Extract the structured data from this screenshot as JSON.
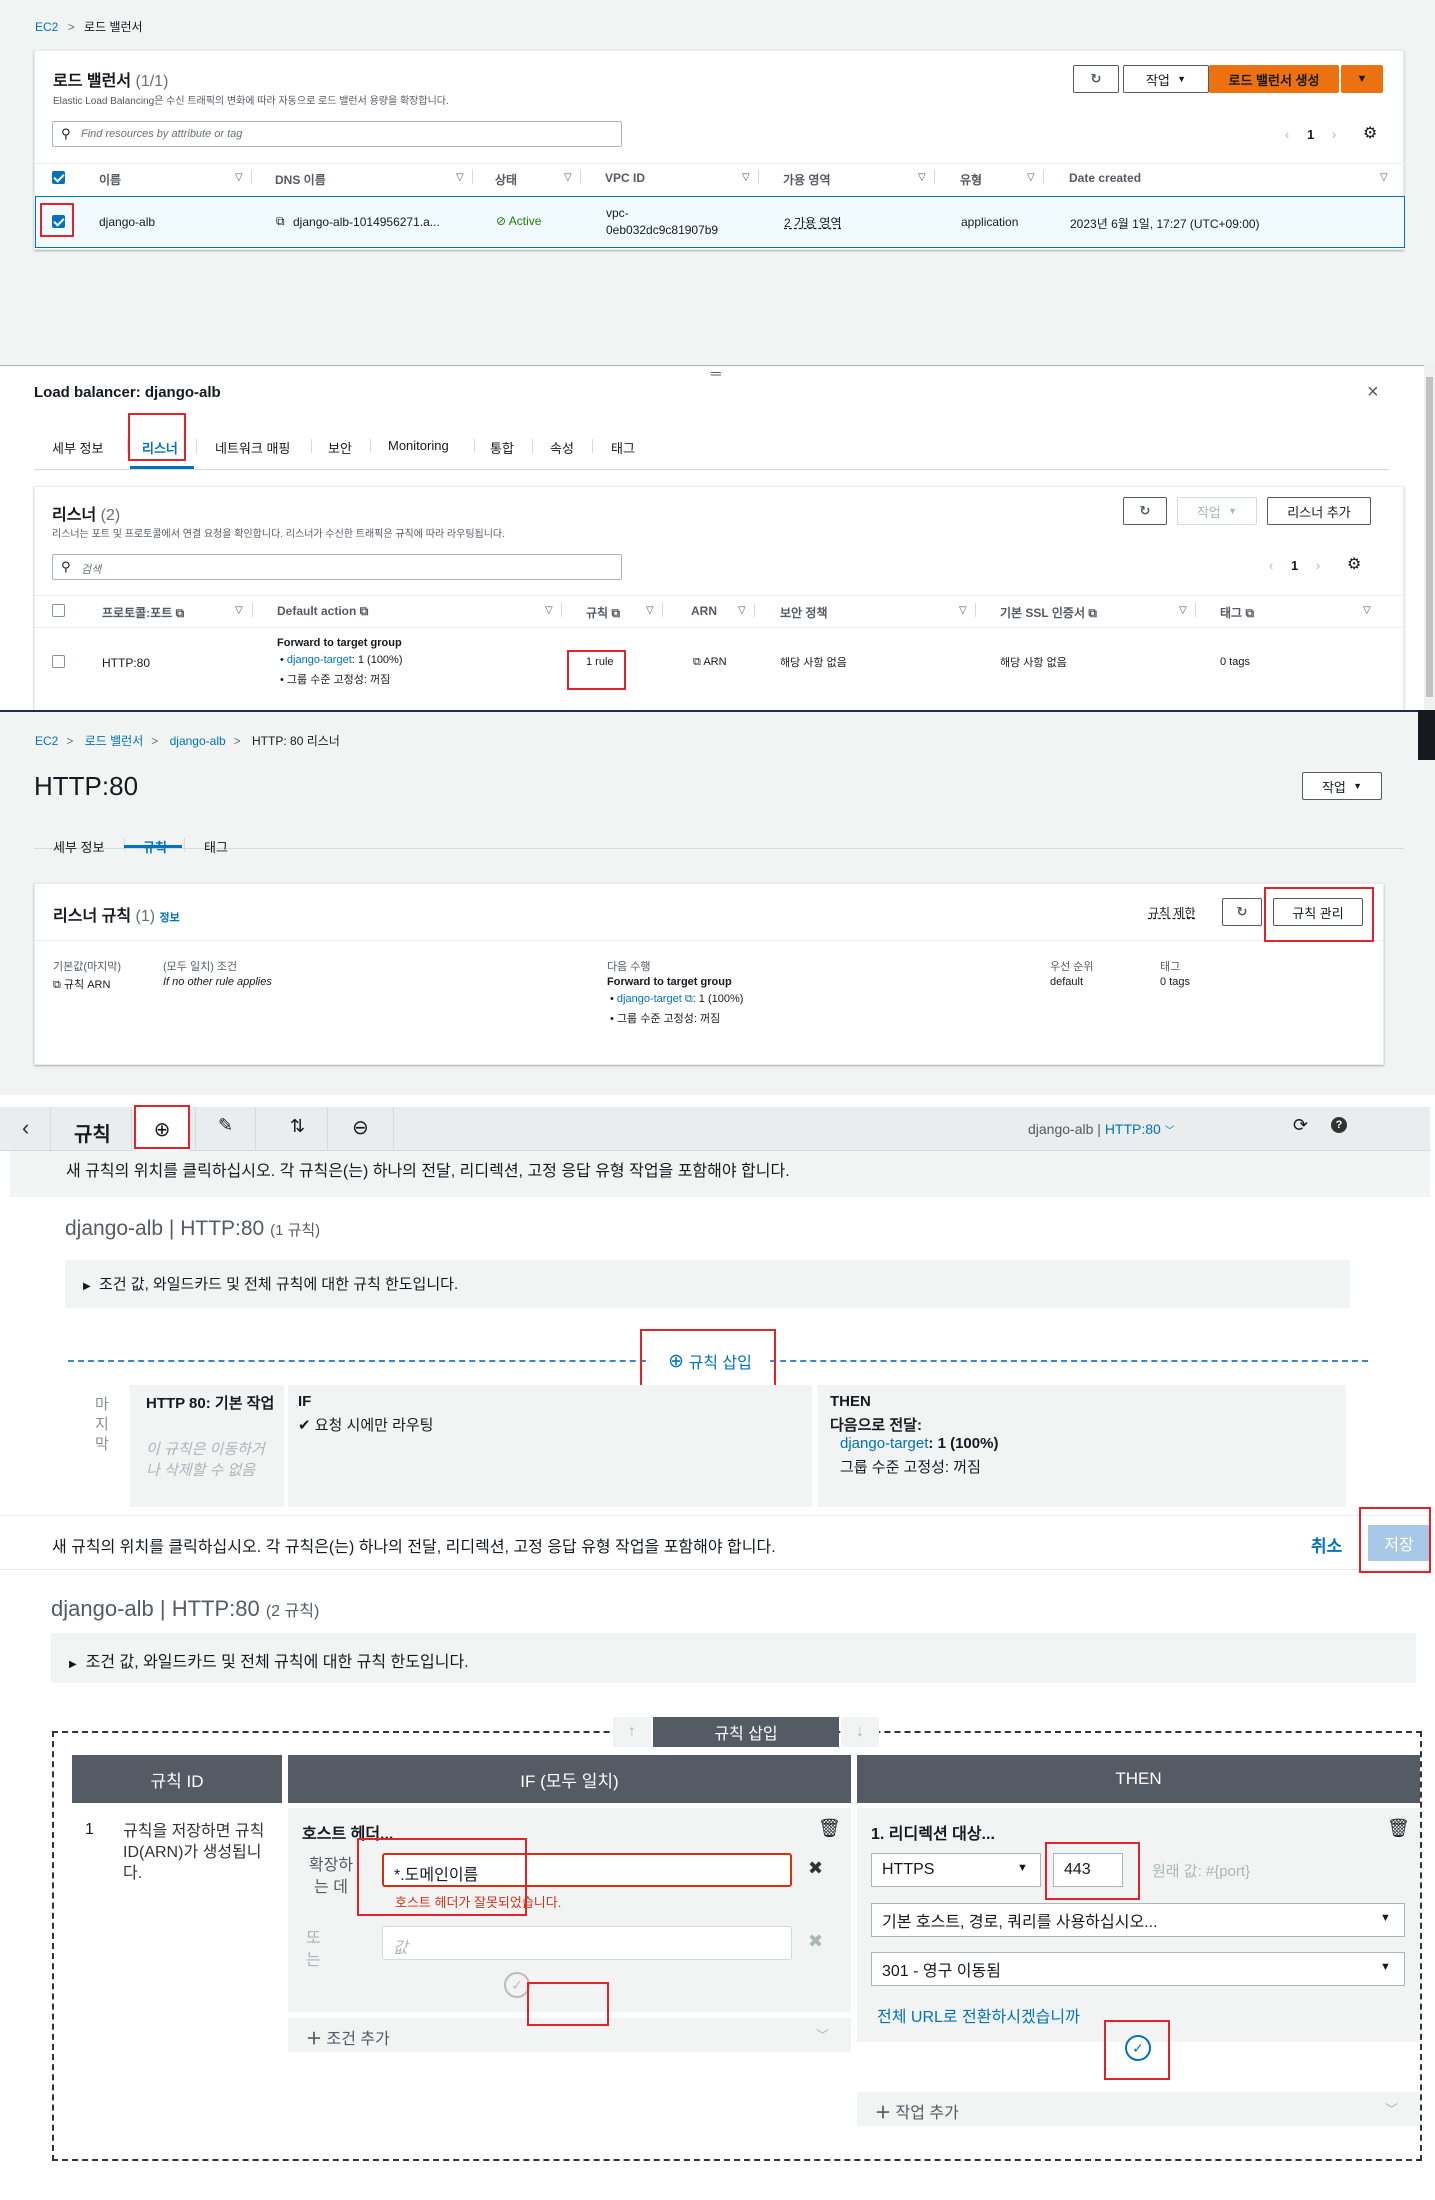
{
  "s1": {
    "breadcrumb": [
      "EC2",
      "로드 밸런서"
    ],
    "title": "로드 밸런서",
    "count": "(1/1)",
    "desc": "Elastic Load Balancing은 수신 트래픽의 변화에 따라 자동으로 로드 밸런서 용량을 확장합니다.",
    "actions_label": "작업",
    "create_label": "로드 밸런서 생성",
    "search_placeholder": "Find resources by attribute or tag",
    "page": "1",
    "columns": [
      "이름",
      "DNS 이름",
      "상태",
      "VPC ID",
      "가용 영역",
      "유형",
      "Date created"
    ],
    "row": {
      "name": "django-alb",
      "dns": "django-alb-1014956271.a...",
      "state": "Active",
      "vpc1": "vpc-",
      "vpc2": "0eb032dc9c81907b9",
      "az": "2 가용 영역",
      "type": "application",
      "created": "2023년 6월 1일, 17:27 (UTC+09:00)"
    }
  },
  "s2": {
    "title": "Load balancer: django-alb",
    "tabs": [
      "세부 정보",
      "리스너",
      "네트워크 매핑",
      "보안",
      "Monitoring",
      "통합",
      "속성",
      "태그"
    ],
    "listeners_title": "리스너",
    "listeners_count": "(2)",
    "listeners_desc": "리스너는 포트 및 프로토콜에서 연결 요청을 확인합니다. 리스너가 수신한 트래픽은 규칙에 따라 라우팅됩니다.",
    "actions_label": "작업",
    "add_listener_label": "리스너 추가",
    "search_placeholder": "검색",
    "page": "1",
    "columns": [
      "프로토콜:포트",
      "Default action",
      "규칙",
      "ARN",
      "보안 정책",
      "기본 SSL 인증서",
      "태그"
    ],
    "row": {
      "protocol": "HTTP:80",
      "fwd": "Forward to target group",
      "target": "django-target",
      "target_pct": ": 1 (100%)",
      "stickiness": "그룹 수준 고정성: 꺼짐",
      "rules": "1 rule",
      "arn": "ARN",
      "policy": "해당 사항 없음",
      "cert": "해당 사항 없음",
      "tags": "0 tags"
    }
  },
  "s3": {
    "breadcrumb": [
      "EC2",
      "로드 밸런서",
      "django-alb",
      "HTTP: 80 리스너"
    ],
    "title": "HTTP:80",
    "actions_label": "작업",
    "tabs": [
      "세부 정보",
      "규칙",
      "태그"
    ],
    "rules_title": "리스너 규칙",
    "rules_count": "(1)",
    "info": "정보",
    "limits_link": "규칙 제한",
    "manage_label": "규칙 관리",
    "col1_h": "기본값(마지막)",
    "col1_v": "규칙 ARN",
    "col2_h": "(모두 일치) 조건",
    "col2_v": "If no other rule applies",
    "col3_h": "다음 수행",
    "col3_fwd": "Forward to target group",
    "col3_target": "django-target",
    "col3_pct": ": 1 (100%)",
    "col3_stick": "그룹 수준 고정성: 꺼짐",
    "col4_h": "우선 순위",
    "col4_v": "default",
    "col5_h": "태그",
    "col5_v": "0 tags"
  },
  "s4": {
    "title": "규칙",
    "context_name": "django-alb",
    "context_listener": "HTTP:80",
    "hint": "새 규칙의 위치를 클릭하십시오. 각 규칙은(는) 하나의 전달, 리디렉션, 고정 응답 유형 작업을 포함해야 합니다.",
    "heading": "django-alb | HTTP:80",
    "heading_count": "(1 규칙)",
    "limits": "조건 값, 와일드카드 및 전체 규칙에 대한 규칙 한도입니다.",
    "insert_label": "규칙 삽입",
    "last_label": "마지막",
    "default_title": "HTTP 80: 기본 작업",
    "default_note": "이 규칙은 이동하거나 삭제할 수 없음",
    "if_label": "IF",
    "if_value": "요청 시에만 라우팅",
    "then_label": "THEN",
    "then_fwd": "다음으로 전달:",
    "then_target": "django-target",
    "then_pct": ": 1 (100%)",
    "then_stick": "그룹 수준 고정성: 꺼짐",
    "cancel_label": "취소",
    "save_label": "저장"
  },
  "s5": {
    "heading": "django-alb | HTTP:80",
    "heading_count": "(2 규칙)",
    "limits": "조건 값, 와일드카드 및 전체 규칙에 대한 규칙 한도입니다.",
    "insert_label": "규칙 삽입",
    "col_id": "규칙 ID",
    "col_if": "IF (모두 일치)",
    "col_then": "THEN",
    "rule_num": "1",
    "rule_note": "규칙을 저장하면 규칙 ID(ARN)가 생성됩니다.",
    "host_header": "호스트 헤더...",
    "is_label": "확장하는 데",
    "host_value": "*.도메인이름",
    "host_error": "호스트 헤더가 잘못되었습니다.",
    "or_label": "또는",
    "value_placeholder": "값",
    "add_condition": "조건 추가",
    "redirect_title": "1. 리디렉션 대상...",
    "protocol": "HTTPS",
    "port": "443",
    "original_value": "원래 값: #{port}",
    "host_path_option": "기본 호스트, 경로, 쿼리를 사용하십시오...",
    "status_option": "301 - 영구 이동됨",
    "full_url_link": "전체 URL로 전환하시겠습니까",
    "add_action": "작업 추가"
  }
}
